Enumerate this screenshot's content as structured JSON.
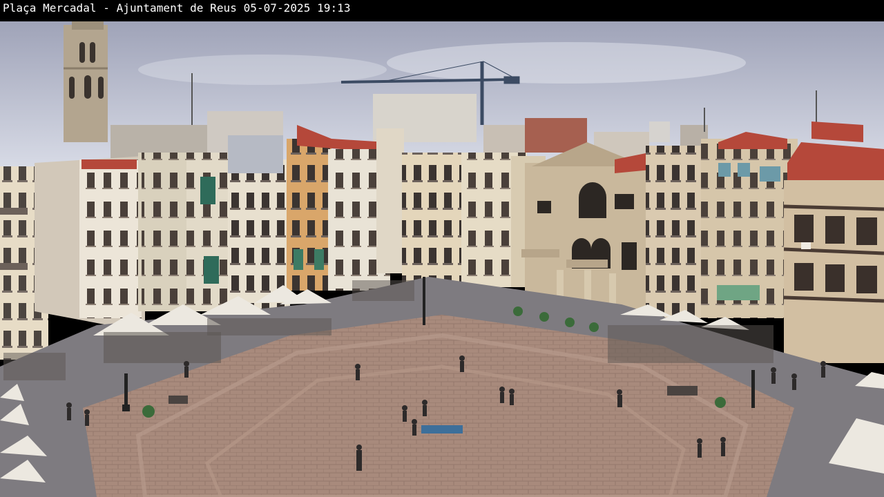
{
  "camera": {
    "caption": "Plaça Mercadal - Ajuntament de Reus 05-07-2025 19:13"
  },
  "palette": {
    "sky_top": "#9fa3b8",
    "sky_bottom": "#d9dde8",
    "plaza_paving": "#a88a7c",
    "plaza_border": "#7e7b80",
    "terrace_umbrella": "#ece8e0",
    "tile_roof": "#b5483a",
    "facade_cream": "#e4d9c4",
    "facade_ochre": "#d9a66a",
    "facade_stone": "#c9b89c"
  },
  "scene": {
    "landmarks": [
      "bell-tower",
      "construction-crane",
      "modernist-facade",
      "half-timbered-house"
    ],
    "activity": "people and café terraces on a paved town square"
  }
}
